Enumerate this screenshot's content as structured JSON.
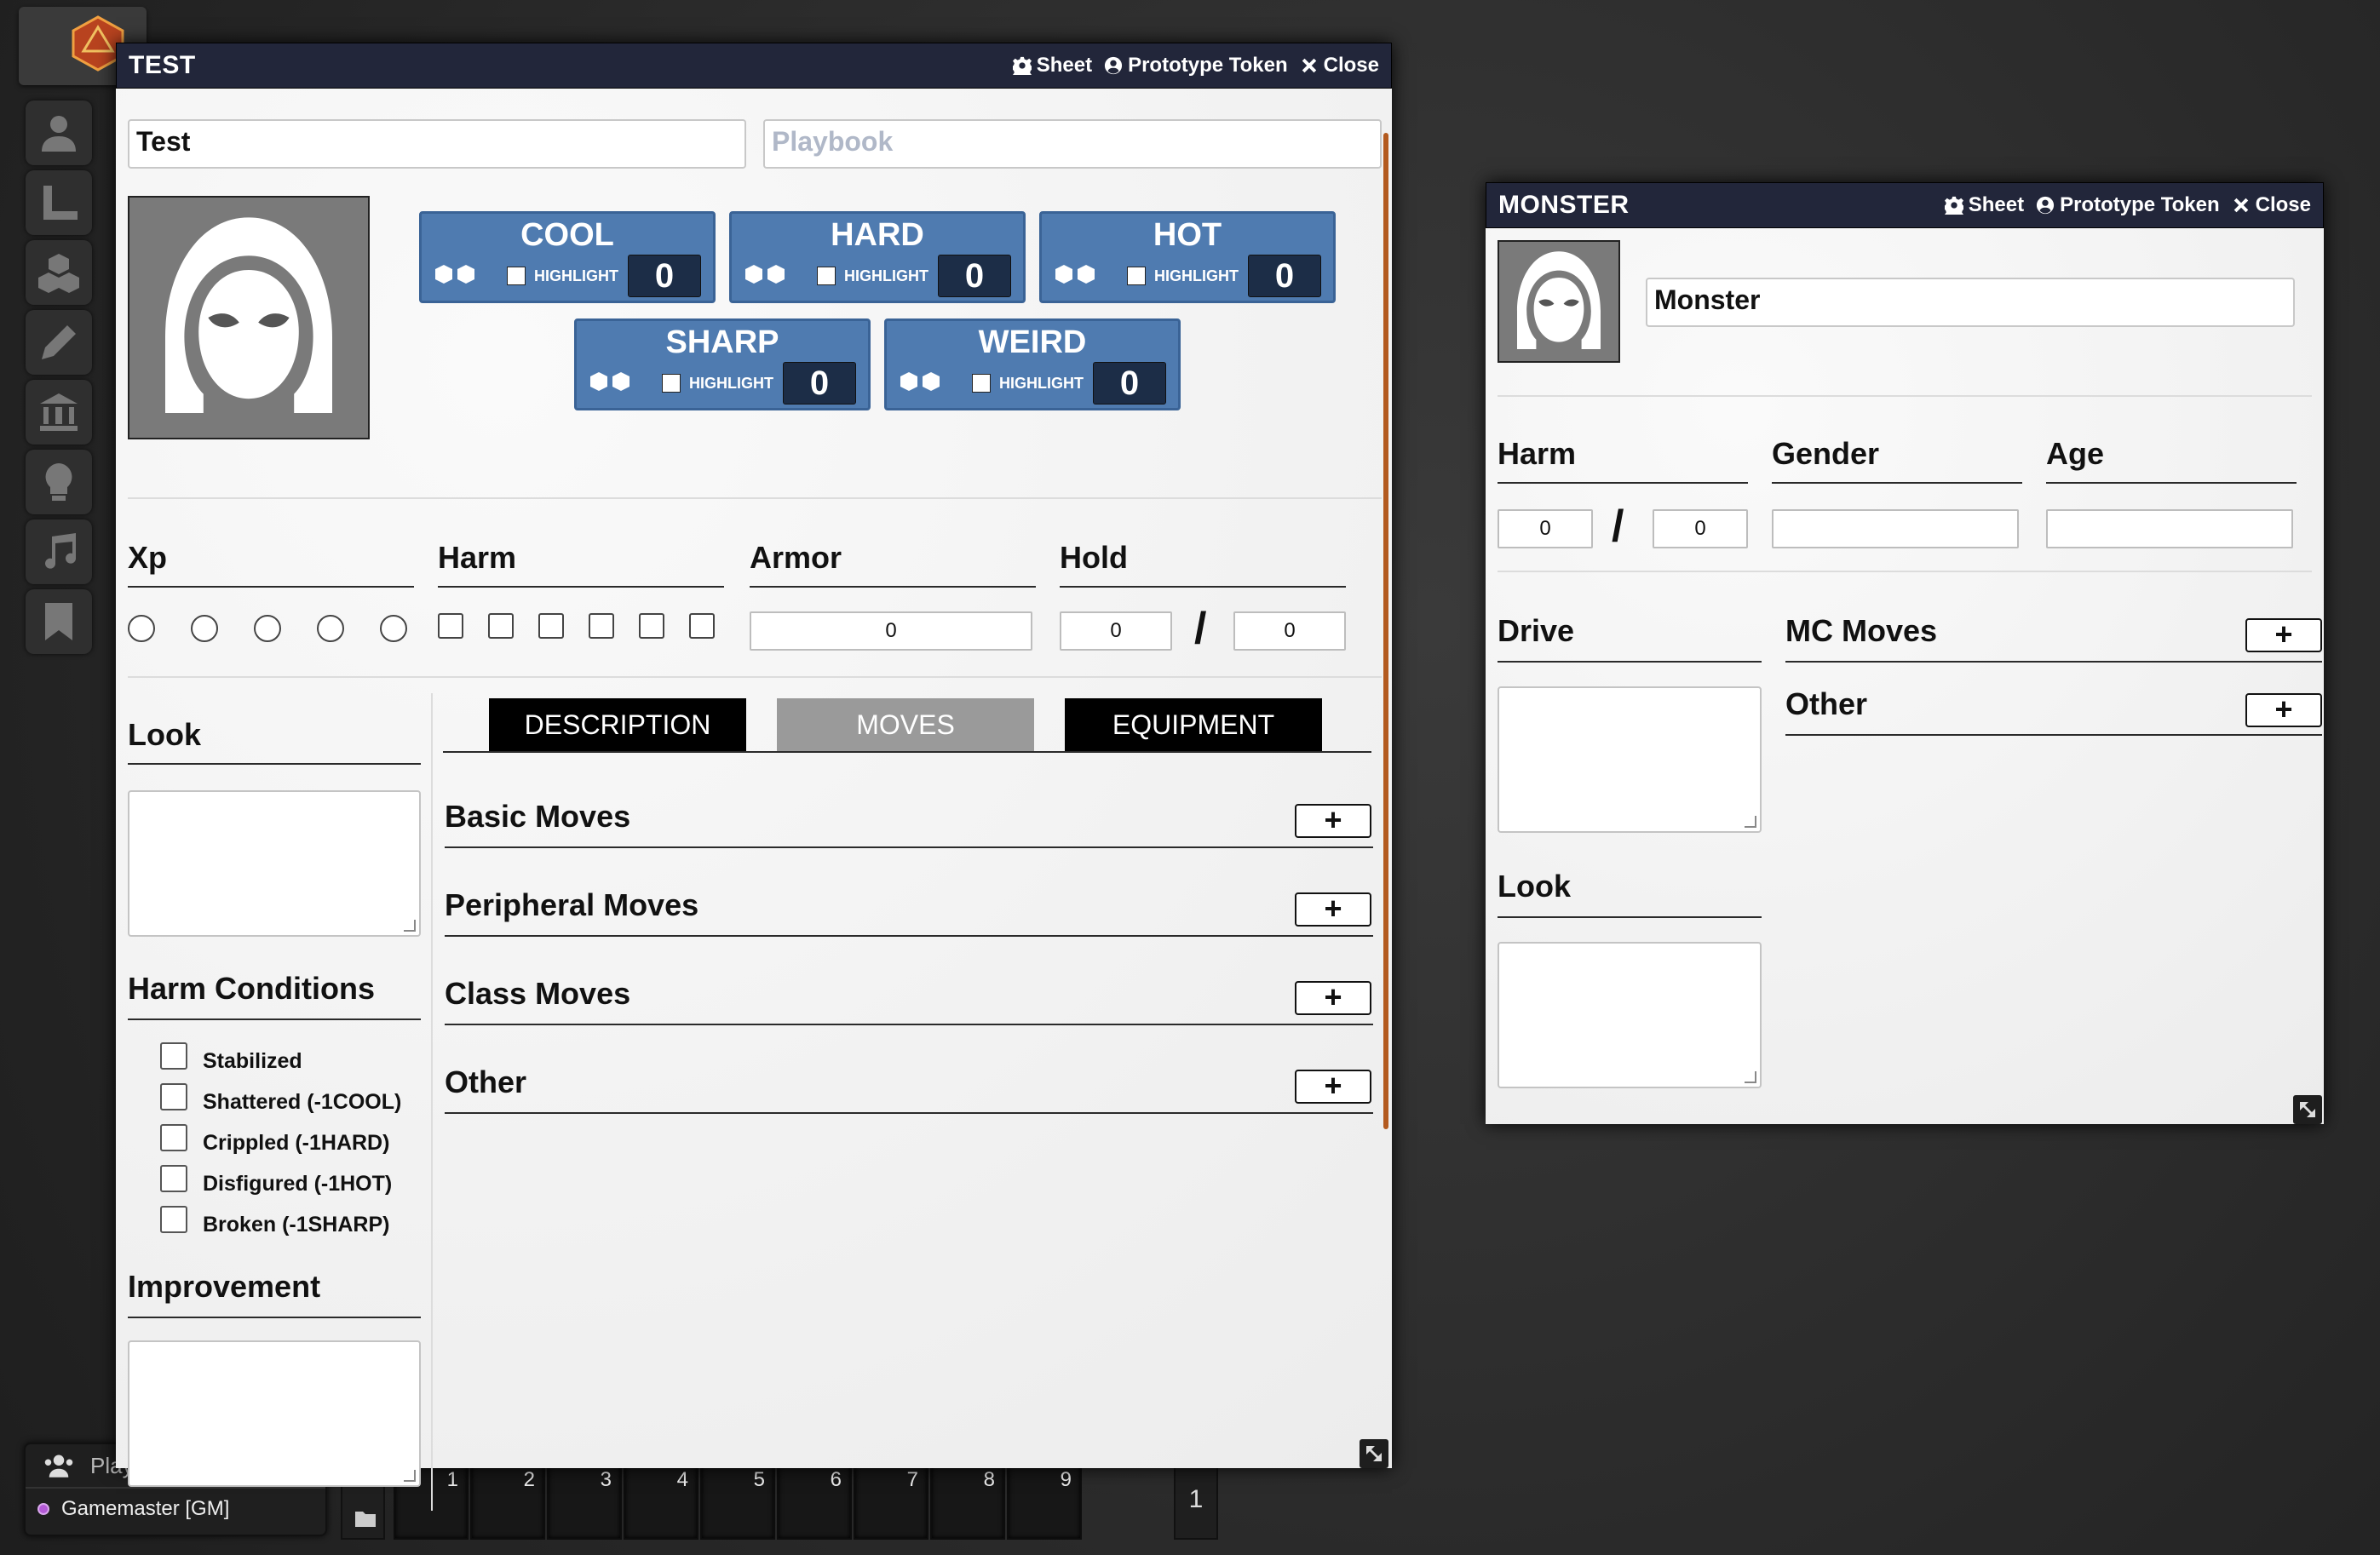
{
  "toolbar": {
    "logo": "d20-icon",
    "controls": [
      "user-icon",
      "ruler-icon",
      "cubes-icon",
      "pencil-icon",
      "landmark-icon",
      "lightbulb-icon",
      "music-icon",
      "bookmark-icon"
    ]
  },
  "players": {
    "header": "Players",
    "list": [
      {
        "name": "Gamemaster [GM]",
        "color": "#b45ad6"
      }
    ]
  },
  "hotbar": {
    "slots": [
      "1",
      "2",
      "3",
      "4",
      "5",
      "6",
      "7",
      "8",
      "9"
    ],
    "page": "1"
  },
  "window_test": {
    "title": "TEST",
    "buttons": {
      "sheet": "Sheet",
      "token": "Prototype Token",
      "close": "Close"
    },
    "name_value": "Test",
    "playbook_placeholder": "Playbook",
    "stats": [
      {
        "name": "COOL",
        "highlight": "HIGHLIGHT",
        "value": "0"
      },
      {
        "name": "HARD",
        "highlight": "HIGHLIGHT",
        "value": "0"
      },
      {
        "name": "HOT",
        "highlight": "HIGHLIGHT",
        "value": "0"
      },
      {
        "name": "SHARP",
        "highlight": "HIGHLIGHT",
        "value": "0"
      },
      {
        "name": "WEIRD",
        "highlight": "HIGHLIGHT",
        "value": "0"
      }
    ],
    "xp_label": "Xp",
    "harm_label": "Harm",
    "armor_label": "Armor",
    "armor_value": "0",
    "hold_label": "Hold",
    "hold_value": "0",
    "hold_max": "0",
    "slash": "/",
    "look_label": "Look",
    "harm_conditions_label": "Harm Conditions",
    "conditions": [
      "Stabilized",
      "Shattered (-1COOL)",
      "Crippled (-1HARD)",
      "Disfigured (-1HOT)",
      "Broken (-1SHARP)"
    ],
    "improvement_label": "Improvement",
    "tabs": [
      "DESCRIPTION",
      "MOVES",
      "EQUIPMENT"
    ],
    "active_tab": "MOVES",
    "move_sections": [
      "Basic Moves",
      "Peripheral Moves",
      "Class Moves",
      "Other"
    ],
    "plus": "+"
  },
  "window_monster": {
    "title": "MONSTER",
    "buttons": {
      "sheet": "Sheet",
      "token": "Prototype Token",
      "close": "Close"
    },
    "name_value": "Monster",
    "harm_label": "Harm",
    "harm_value": "0",
    "harm_max": "0",
    "slash": "/",
    "gender_label": "Gender",
    "age_label": "Age",
    "drive_label": "Drive",
    "mc_moves_label": "MC Moves",
    "other_label": "Other",
    "look_label": "Look",
    "plus": "+"
  },
  "colors": {
    "stat_blue": "#4f7bb0",
    "header_navy": "#22263a",
    "scroll_accent": "#b35a1f"
  }
}
